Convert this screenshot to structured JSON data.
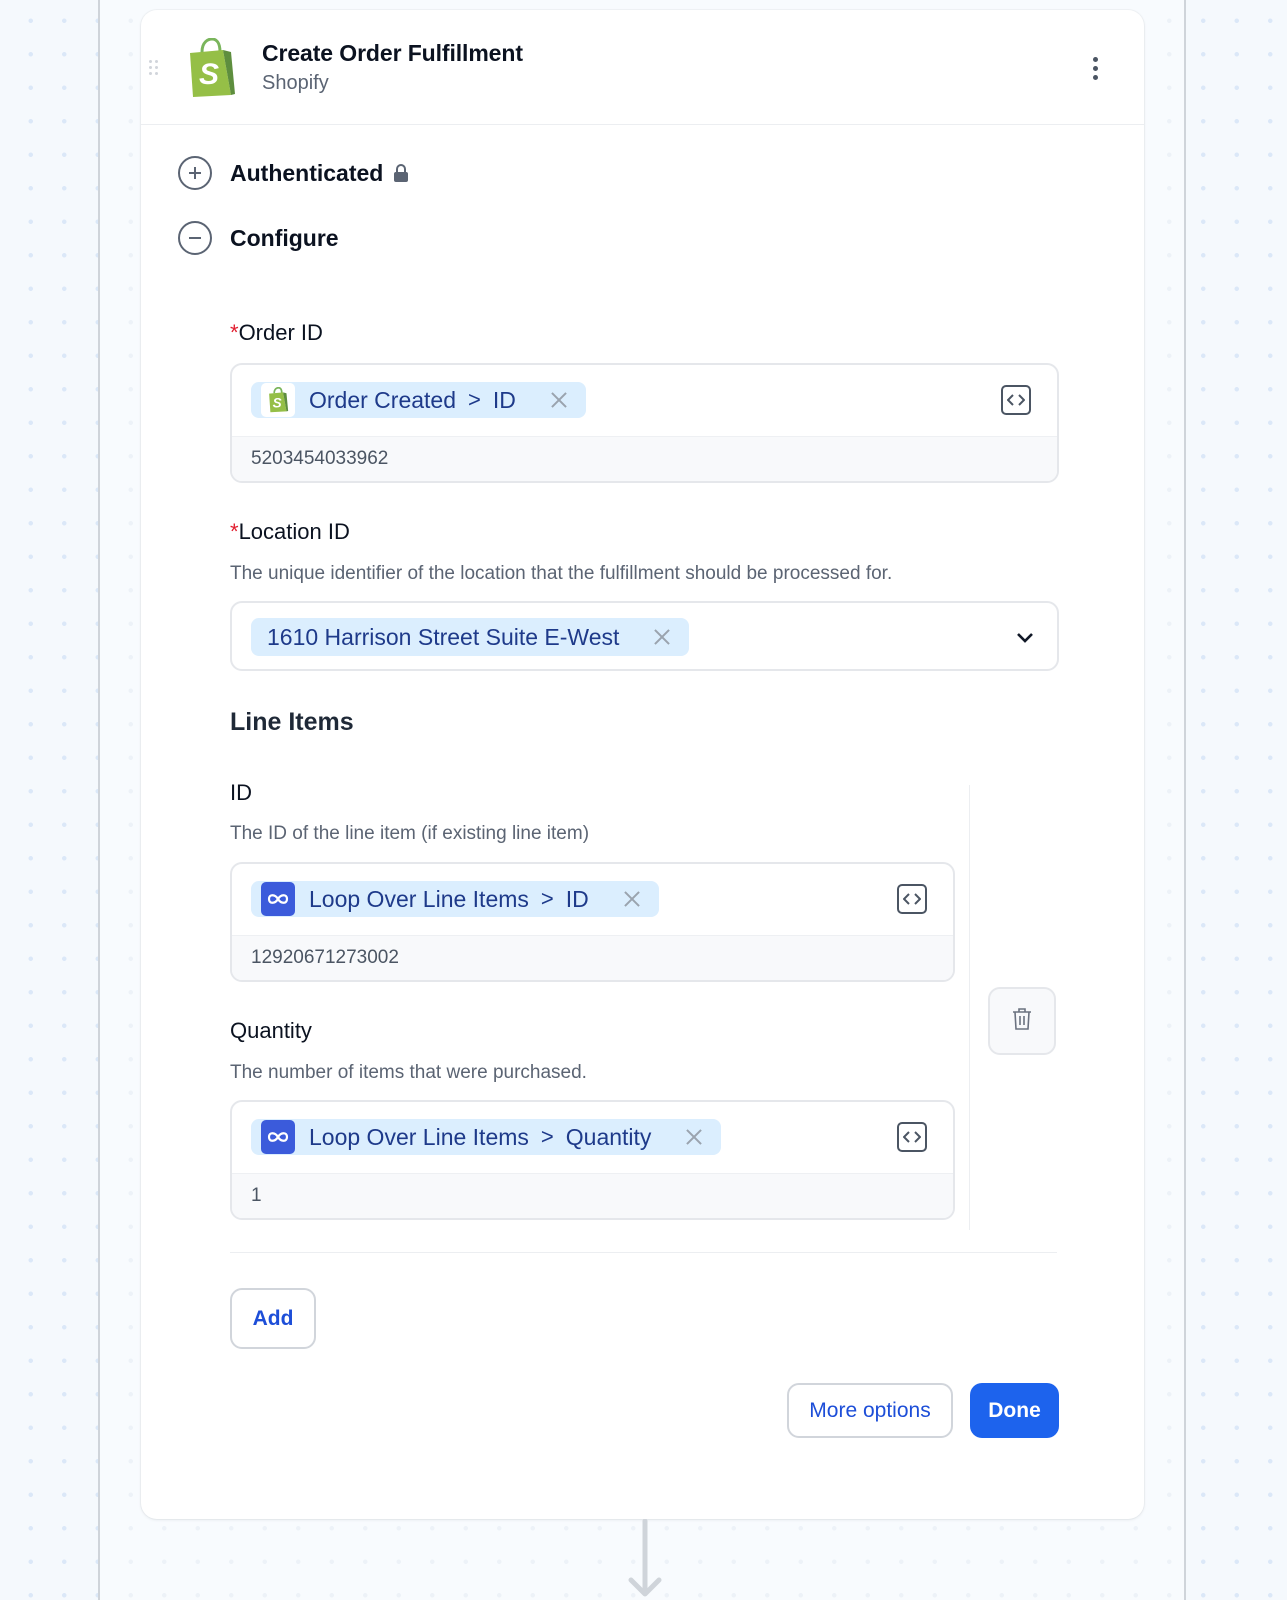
{
  "step": {
    "title": "Create Order Fulfillment",
    "app_name": "Shopify",
    "menu_icon": "more-vertical-icon",
    "drag_icon": "drag-handle-icon"
  },
  "sections": {
    "authenticated": {
      "label": "Authenticated",
      "state": "collapsed",
      "icon": "plus-circle-icon",
      "badge_icon": "lock-icon"
    },
    "configure": {
      "label": "Configure",
      "state": "expanded",
      "icon": "minus-circle-icon"
    }
  },
  "fields": {
    "order_id": {
      "required_mark": "*",
      "label": "Order ID",
      "chip": {
        "source_icon": "shopify-icon",
        "source": "Order Created",
        "separator": ">",
        "field": "ID"
      },
      "resolved_value": "5203454033962"
    },
    "location_id": {
      "required_mark": "*",
      "label": "Location ID",
      "description": "The unique identifier of the location that the fulfillment should be processed for.",
      "selected_value": "1610 Harrison Street Suite E-West"
    }
  },
  "line_items": {
    "title": "Line Items",
    "items": [
      {
        "id_field": {
          "label": "ID",
          "description": "The ID of the line item (if existing line item)",
          "chip": {
            "source_icon": "loop-icon",
            "source": "Loop Over Line Items",
            "separator": ">",
            "field": "ID"
          },
          "resolved_value": "12920671273002"
        },
        "quantity_field": {
          "label": "Quantity",
          "description": "The number of items that were purchased.",
          "chip": {
            "source_icon": "loop-icon",
            "source": "Loop Over Line Items",
            "separator": ">",
            "field": "Quantity"
          },
          "resolved_value": "1"
        }
      }
    ],
    "add_label": "Add"
  },
  "footer": {
    "more_options_label": "More options",
    "done_label": "Done"
  },
  "colors": {
    "primary": "#1d63ed",
    "chip_bg": "#dbeefe",
    "chip_text": "#1e3a8a",
    "required": "#e11d2e",
    "shopify_green": "#95bf47",
    "loop_icon_bg": "#3b5bdb"
  }
}
